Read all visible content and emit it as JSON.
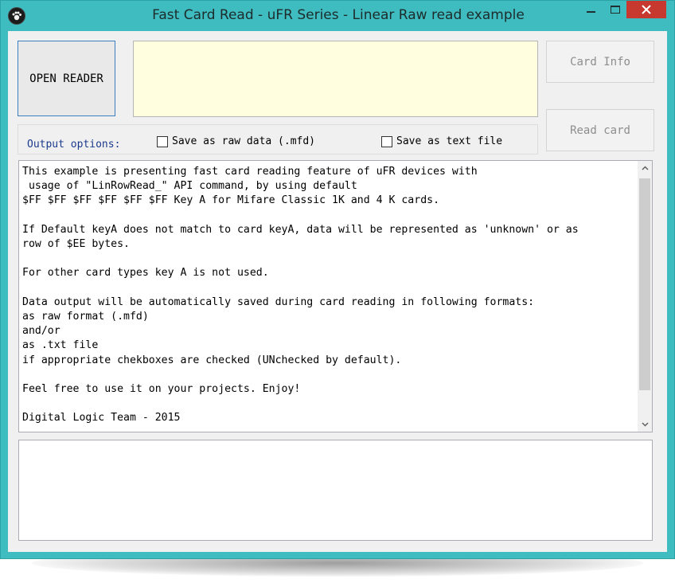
{
  "window": {
    "title": "Fast Card Read - uFR Series - Linear Raw read example",
    "accent": "#3fbcc0",
    "close_color": "#c7382f"
  },
  "buttons": {
    "open_reader": "OPEN READER",
    "card_info": "Card Info",
    "read_card": "Read card"
  },
  "status": {
    "text": ""
  },
  "options": {
    "label": "Output options:",
    "save_raw": {
      "label": "Save as raw data (.mfd)",
      "checked": false
    },
    "save_text": {
      "label": "Save as text file",
      "checked": false
    }
  },
  "memo": {
    "text": "This example is presenting fast card reading feature of uFR devices with\n usage of \"LinRowRead_\" API command, by using default\n$FF $FF $FF $FF $FF $FF Key A for Mifare Classic 1K and 4 K cards.\n\nIf Default keyA does not match to card keyA, data will be represented as 'unknown' or as\nrow of $EE bytes.\n\nFor other card types key A is not used.\n\nData output will be automatically saved during card reading in following formats:\nas raw format (.mfd)\nand/or\nas .txt file\nif appropriate chekboxes are checked (UNchecked by default).\n\nFeel free to use it on your projects. Enjoy!\n\nDigital Logic Team - 2015"
  },
  "output_box": {
    "text": ""
  },
  "icons": {
    "app": "paw-icon",
    "minimize": "minimize-icon",
    "maximize": "maximize-icon",
    "close": "close-icon"
  }
}
